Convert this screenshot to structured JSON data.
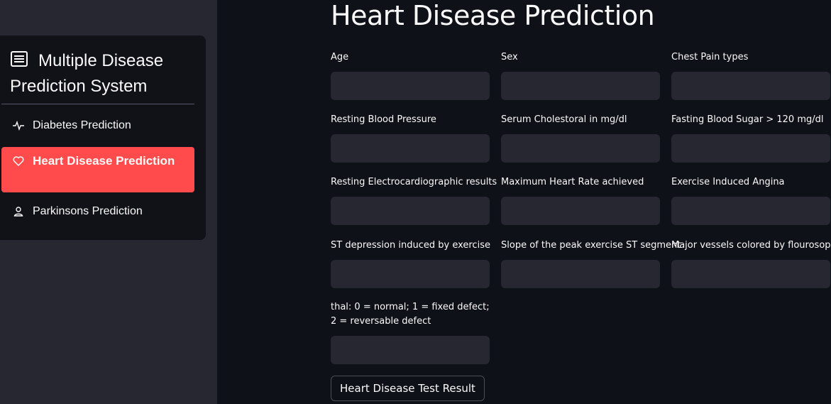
{
  "sidebar": {
    "title": "Multiple Disease Prediction System",
    "menu": [
      {
        "label": "Diabetes Prediction",
        "icon": "activity-icon",
        "selected": false
      },
      {
        "label": "Heart Disease Prediction",
        "icon": "heart-icon",
        "selected": true
      },
      {
        "label": "Parkinsons Prediction",
        "icon": "person-icon",
        "selected": false
      }
    ]
  },
  "main": {
    "title": "Heart Disease Prediction",
    "fields": [
      {
        "label": "Age",
        "value": ""
      },
      {
        "label": "Sex",
        "value": ""
      },
      {
        "label": "Chest Pain types",
        "value": ""
      },
      {
        "label": "Resting Blood Pressure",
        "value": ""
      },
      {
        "label": "Serum Cholestoral in mg/dl",
        "value": ""
      },
      {
        "label": "Fasting Blood Sugar > 120 mg/dl",
        "value": ""
      },
      {
        "label": "Resting Electrocardiographic results",
        "value": ""
      },
      {
        "label": "Maximum Heart Rate achieved",
        "value": ""
      },
      {
        "label": "Exercise Induced Angina",
        "value": ""
      },
      {
        "label": "ST depression induced by exercise",
        "value": ""
      },
      {
        "label": "Slope of the peak exercise ST segment",
        "value": ""
      },
      {
        "label": "Major vessels colored by flourosopy",
        "value": ""
      },
      {
        "label": "thal: 0 = normal; 1 = fixed defect; 2 = reversable defect",
        "value": ""
      }
    ],
    "submit_label": "Heart Disease Test Result"
  },
  "colors": {
    "background": "#0e1117",
    "sidebar": "#262730",
    "accent": "#ff4b4b",
    "input": "#262730"
  }
}
